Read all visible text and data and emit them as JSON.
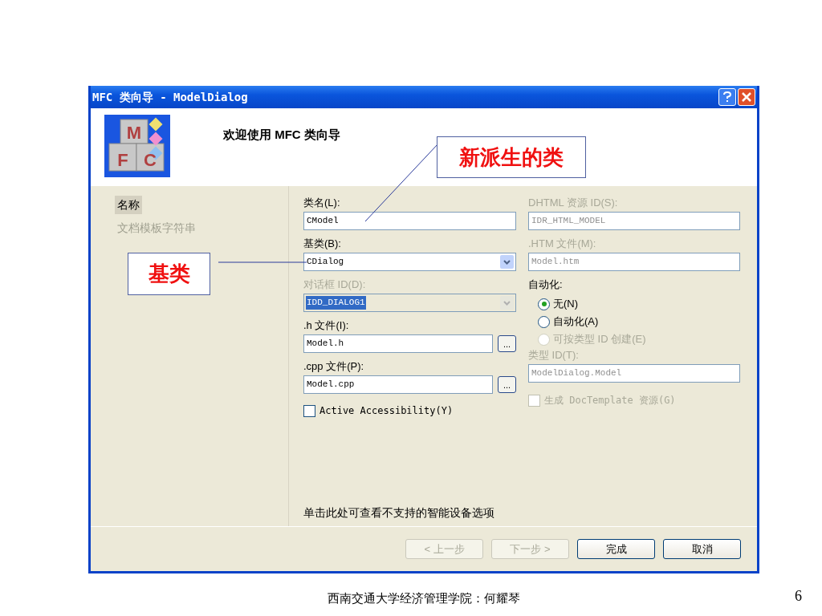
{
  "window": {
    "title": "MFC 类向导 - ModelDialog",
    "logo_letters": [
      "M",
      "F",
      "C"
    ],
    "header": "欢迎使用 MFC 类向导"
  },
  "sidebar": {
    "items": [
      {
        "label": "名称",
        "selected": true
      },
      {
        "label": "文档模板字符串",
        "selected": false
      }
    ]
  },
  "left_fields": [
    {
      "kind": "text",
      "label": "类名(L):",
      "value": "CModel",
      "disabled": false
    },
    {
      "kind": "combo",
      "label": "基类(B):",
      "value": "CDialog",
      "disabled": false,
      "value_selected": false
    },
    {
      "kind": "combo",
      "label": "对话框 ID(D):",
      "value": "IDD_DIALOG1",
      "disabled": true,
      "value_selected": true
    },
    {
      "kind": "browse",
      "label": ".h 文件(I):",
      "value": "Model.h",
      "disabled": false,
      "button": "..."
    },
    {
      "kind": "browse",
      "label": ".cpp 文件(P):",
      "value": "Model.cpp",
      "disabled": false,
      "button": "..."
    }
  ],
  "left_checkbox": {
    "label": "Active Accessibility(Y)",
    "checked": false,
    "disabled": false
  },
  "right_fields": [
    {
      "kind": "text",
      "label": "DHTML 资源 ID(S):",
      "value": "IDR_HTML_MODEL",
      "disabled": true
    },
    {
      "kind": "text",
      "label": ".HTM 文件(M):",
      "value": "Model.htm",
      "disabled": true
    }
  ],
  "automation": {
    "label": "自动化:",
    "options": [
      {
        "label": "无(N)",
        "selected": true,
        "disabled": false
      },
      {
        "label": "自动化(A)",
        "selected": false,
        "disabled": false
      },
      {
        "label": "可按类型 ID 创建(E)",
        "selected": false,
        "disabled": true
      }
    ]
  },
  "type_id": {
    "label": "类型 ID(T):",
    "value": "ModelDialog.Model",
    "disabled": true
  },
  "right_checkbox": {
    "label": "生成 DocTemplate 资源(G)",
    "checked": false,
    "disabled": true
  },
  "link": "单击此处可查看不支持的智能设备选项",
  "buttons": [
    {
      "label": "< 上一步",
      "disabled": true
    },
    {
      "label": "下一步 >",
      "disabled": true
    },
    {
      "label": "完成",
      "disabled": false
    },
    {
      "label": "取消",
      "disabled": false
    }
  ],
  "callouts": [
    {
      "text": "新派生的类"
    },
    {
      "text": "基类"
    }
  ],
  "slide": {
    "footer": "西南交通大学经济管理学院：何耀琴",
    "page_number": "6"
  }
}
